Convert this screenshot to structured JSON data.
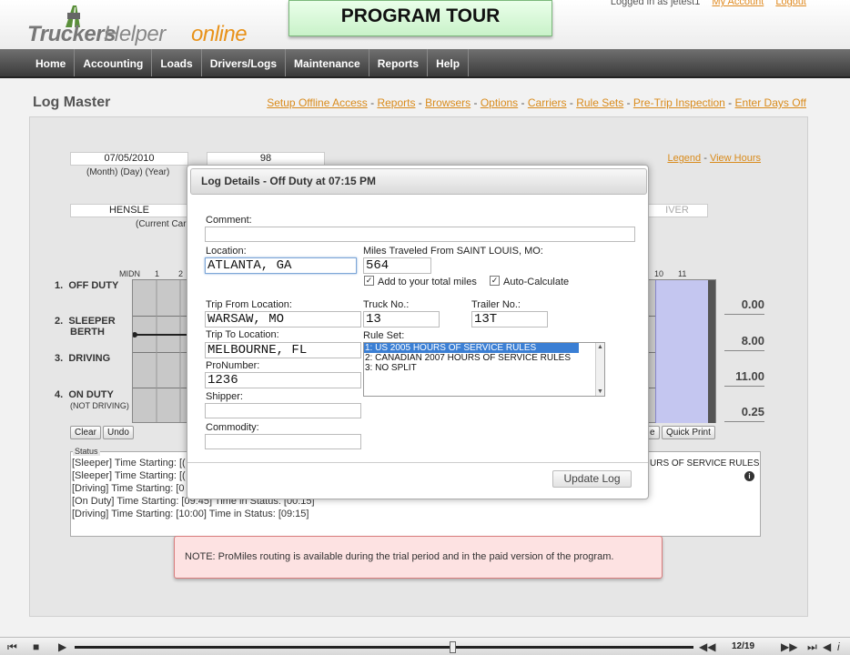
{
  "header": {
    "logo_part1": "Truckers",
    "logo_part2": "Helper",
    "logo_part3": "online",
    "tour_banner": "PROGRAM TOUR",
    "logged_in_as": "Logged in as jetest1",
    "my_account": "My Account",
    "logout": "Logout"
  },
  "nav": {
    "items": [
      "Home",
      "Accounting",
      "Loads",
      "Drivers/Logs",
      "Maintenance",
      "Reports",
      "Help"
    ]
  },
  "page": {
    "title": "Log Master",
    "top_links": [
      "Setup Offline Access",
      "Reports",
      "Browsers",
      "Options",
      "Carriers",
      "Rule Sets",
      "Pre-Trip Inspection",
      "Enter Days Off"
    ],
    "date_value": "07/05/2010",
    "date_caption": "(Month) (Day) (Year)",
    "number_value": "98",
    "carrier_value": "HENSLE",
    "carrier_caption": "(Current Car",
    "driver_value": "IVER",
    "legend_link": "Legend",
    "view_hours_link": "View Hours"
  },
  "grid": {
    "hour_labels": [
      "MIDN",
      "1",
      "2",
      "10",
      "11"
    ],
    "rows": [
      {
        "num": "1.",
        "label": "OFF DUTY",
        "sub": "",
        "total": "0.00"
      },
      {
        "num": "2.",
        "label": "SLEEPER",
        "sub": "BERTH",
        "total": "8.00"
      },
      {
        "num": "3.",
        "label": "DRIVING",
        "sub": "",
        "total": "11.00"
      },
      {
        "num": "4.",
        "label": "ON DUTY",
        "sub": "(NOT DRIVING)",
        "total": "0.25"
      }
    ],
    "clear_label": "Clear",
    "undo_label": "Undo",
    "partial_btn_label": "e",
    "quick_print_label": "Quick Print"
  },
  "status": {
    "caption": "Status",
    "lines": [
      "[Sleeper] Time Starting: [(",
      "[Sleeper] Time Starting: [(",
      "[Driving] Time Starting: [0",
      "[On Duty] Time Starting: [09:45] Time in Status: [00:15]",
      "[Driving] Time Starting: [10:00] Time in Status: [09:15]"
    ],
    "rules_text": "URS OF SERVICE RULES"
  },
  "note": "NOTE: ProMiles routing is available during the trial period and in the paid version of the program.",
  "dialog": {
    "title": "Log Details - Off Duty at 07:15 PM",
    "comment_label": "Comment:",
    "comment_value": "",
    "location_label": "Location:",
    "location_value": "ATLANTA, GA",
    "miles_label": "Miles Traveled From SAINT LOUIS, MO:",
    "miles_value": "564",
    "add_total_label": "Add to your total miles",
    "auto_calc_label": "Auto-Calculate",
    "trip_from_label": "Trip From Location:",
    "trip_from_value": "WARSAW, MO",
    "truck_label": "Truck No.:",
    "truck_value": "13",
    "trailer_label": "Trailer No.:",
    "trailer_value": "13T",
    "trip_to_label": "Trip To Location:",
    "trip_to_value": "MELBOURNE, FL",
    "ruleset_label": "Rule Set:",
    "ruleset_options": [
      "1: US 2005 HOURS OF SERVICE RULES",
      "2: CANADIAN 2007 HOURS OF SERVICE RULES",
      "3: NO SPLIT"
    ],
    "pronumber_label": "ProNumber:",
    "pronumber_value": "1236",
    "shipper_label": "Shipper:",
    "shipper_value": "",
    "commodity_label": "Commodity:",
    "commodity_value": "",
    "update_label": "Update Log"
  },
  "video": {
    "counter": "12/19",
    "progress": 0.61
  }
}
